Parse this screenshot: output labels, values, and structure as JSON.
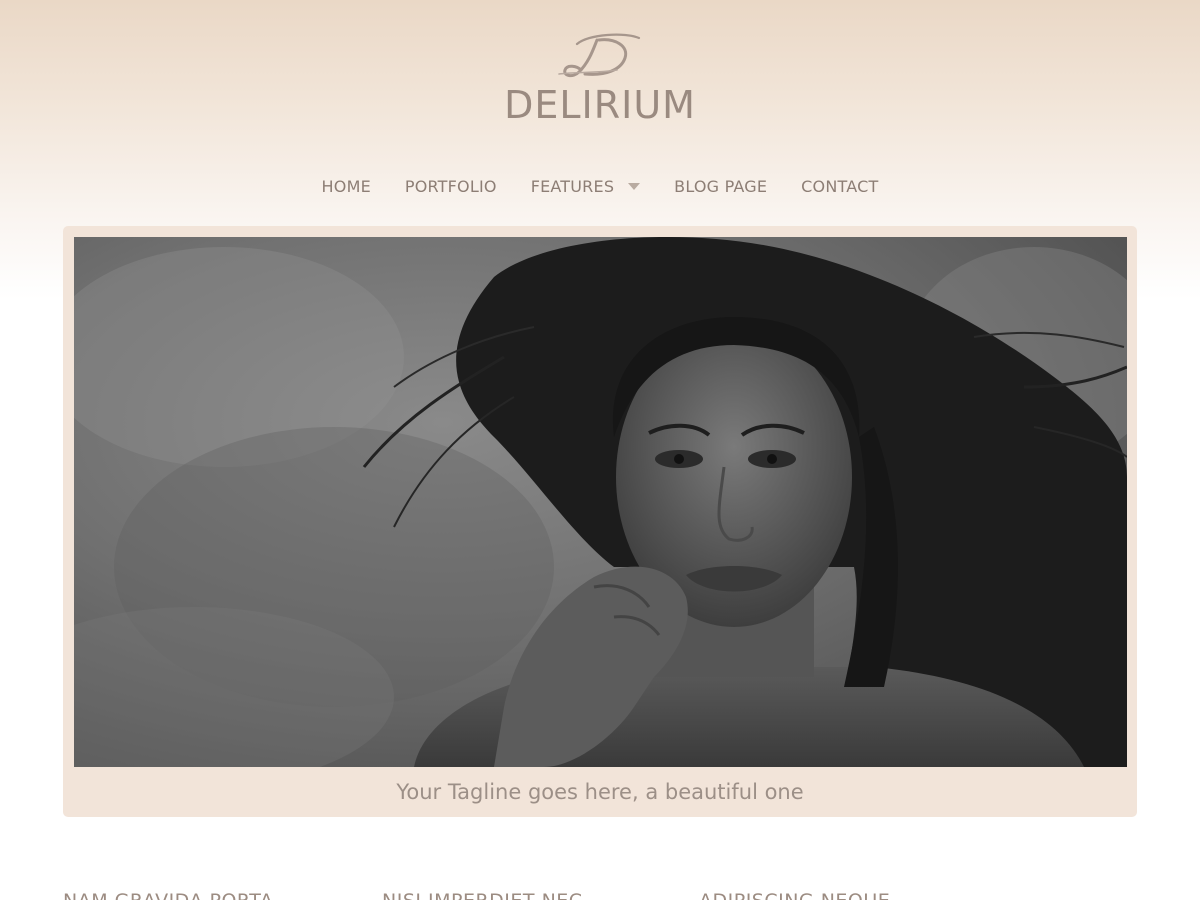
{
  "site": {
    "logo_icon": "script-d-monogram",
    "title": "DELIRIUM"
  },
  "nav": {
    "items": [
      {
        "label": "HOME"
      },
      {
        "label": "PORTFOLIO"
      },
      {
        "label": "FEATURES",
        "has_dropdown": true
      },
      {
        "label": "BLOG PAGE"
      },
      {
        "label": "CONTACT"
      }
    ]
  },
  "hero": {
    "image_alt": "Black and white portrait of a woman with windswept hair",
    "tagline": "Your Tagline goes here, a beautiful one"
  },
  "columns": [
    {
      "heading": "NAM GRAVIDA PORTA"
    },
    {
      "heading": "NISI IMPERDIET NEC"
    },
    {
      "heading": "ADIPISCING NEQUE"
    }
  ],
  "colors": {
    "header_top": "#ead8c6",
    "frame": "#f2e4d9",
    "text": "#8d7e75"
  }
}
